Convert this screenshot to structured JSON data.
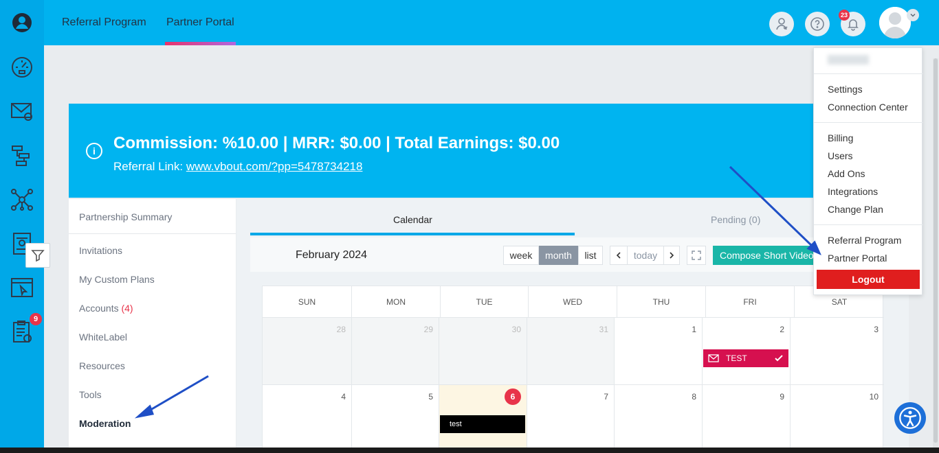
{
  "header": {
    "tabs": [
      {
        "label": "Referral Program"
      },
      {
        "label": "Partner Portal"
      }
    ],
    "notification_count": "23"
  },
  "sidebar": {
    "tasks_badge": "9"
  },
  "banner": {
    "headline": "Commission: %10.00 | MRR: $0.00 | Total Earnings: $0.00",
    "link_label": "Referral Link: ",
    "link": "www.vbout.com/?pp=5478734218"
  },
  "left_nav": {
    "summary": "Partnership Summary",
    "items": [
      {
        "label": "Invitations"
      },
      {
        "label": "My Custom Plans"
      },
      {
        "label": "Accounts ",
        "count": "(4)"
      },
      {
        "label": "WhiteLabel"
      },
      {
        "label": "Resources"
      },
      {
        "label": "Tools"
      },
      {
        "label": "Moderation"
      }
    ]
  },
  "content": {
    "tabs": [
      {
        "label": "Calendar"
      },
      {
        "label": "Pending (0)"
      }
    ],
    "month_title": "February 2024",
    "views": [
      "week",
      "month",
      "list"
    ],
    "today_label": "today",
    "compose_label": "Compose Short Video",
    "days": [
      "SUN",
      "MON",
      "TUE",
      "WED",
      "THU",
      "FRI",
      "SAT"
    ],
    "week1": [
      "28",
      "29",
      "30",
      "31",
      "1",
      "2",
      "3"
    ],
    "week2": [
      "4",
      "5",
      "6",
      "7",
      "8",
      "9",
      "10"
    ],
    "events": [
      {
        "label": "TEST"
      },
      {
        "label": "test"
      }
    ]
  },
  "dropdown": {
    "groups": [
      [
        "Settings",
        "Connection Center"
      ],
      [
        "Billing",
        "Users",
        "Add Ons",
        "Integrations",
        "Change Plan"
      ],
      [
        "Referral Program",
        "Partner Portal"
      ]
    ],
    "logout": "Logout"
  }
}
